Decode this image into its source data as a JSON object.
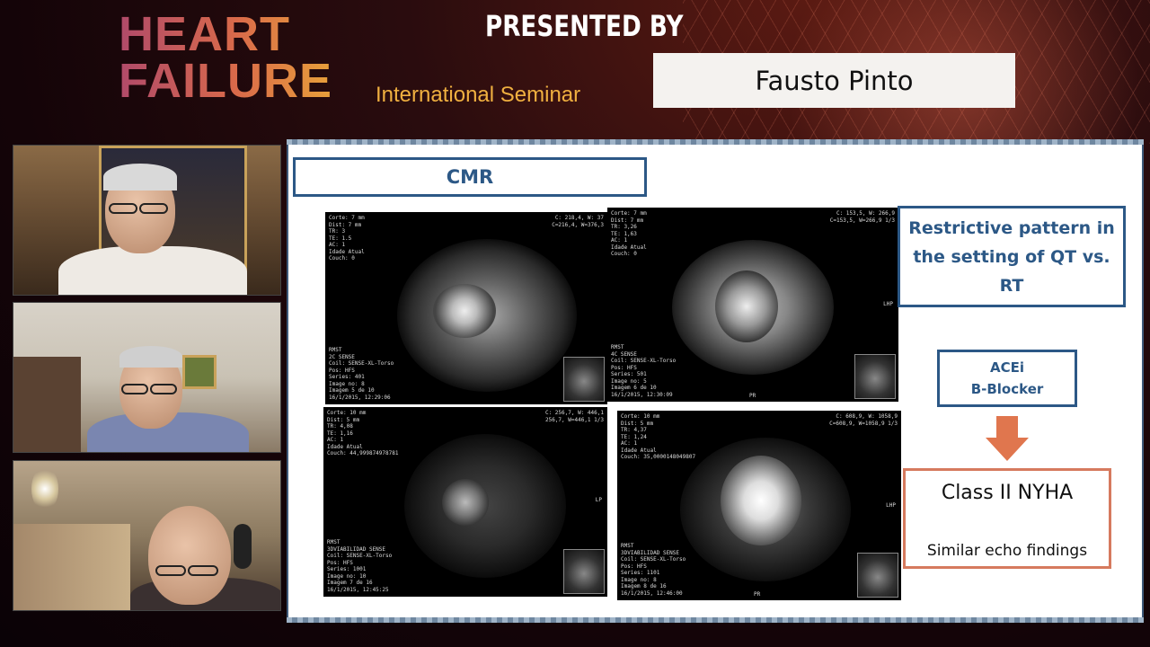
{
  "header": {
    "logo_line1": "HEART",
    "logo_line2": "FAILURE",
    "seminar": "International Seminar",
    "presented_by": "PRESENTED BY",
    "presenter_name": "Fausto Pinto"
  },
  "slide": {
    "title": "CMR",
    "restrictive_text": "Restrictive pattern in the setting of QT vs. RT",
    "drugs_line1": "ACEi",
    "drugs_line2": "B-Blocker",
    "class_title": "Class II NYHA",
    "class_sub": "Similar echo findings",
    "images": [
      {
        "meta_tl": "Corte: 7 mm\nDist: 7 mm\nTR: 3\nTE: 1.5\nAC: 1\nIdade Atual\nCouch: 0",
        "meta_tr": "C: 218,4, W: 37\nC=216,4, W=376,3",
        "meta_bl": "RMST\n2C SENSE\nCoil: SENSE-XL-Torso\nPos: HFS\nSeries: 401\nImage no: 8\nImagem 5 de 10\n16/1/2015, 12:29:06"
      },
      {
        "meta_tl": "Corte: 7 mm\nDist: 7 mm\nTR: 3,26\nTE: 1,63\nAC: 1\nIdade Atual\nCouch: 0",
        "meta_tr": "C: 153,5, W: 266,9\nC=153,5, W=266,9 1/3",
        "meta_bl": "RMST\n4C SENSE\nCoil: SENSE-XL-Torso\nPos: HFS\nSeries: 501\nImage no: 5\nImagem 6 de 10\n16/1/2015, 12:30:09",
        "side": "LHP",
        "bottom": "PR"
      },
      {
        "meta_tl": "Corte: 10 mm\nDist: 5 mm\nTR: 4,08\nTE: 1,16\nAC: 1\nIdade Atual\nCouch: 44,999874978781",
        "meta_tr": "C: 256,7, W: 446,1\n256,7, W=446,1 1/3",
        "meta_bl": "RMST\n3DVIABILIDAD SENSE\nCoil: SENSE-XL-Torso\nPos: HFS\nSeries: 1001\nImage no: 10\nImagem 7 de 16\n16/1/2015, 12:45:25",
        "side": "LP"
      },
      {
        "meta_tl": "Corte: 10 mm\nDist: 5 mm\nTR: 4,37\nTE: 1,24\nAC: 1\nIdade Atual\nCouch: 35,0000148049807",
        "meta_tr": "C: 608,9, W: 1058,9\nC=608,9, W=1058,9 1/3",
        "meta_bl": "RMST\n3DVIABILIDAD SENSE\nCoil: SENSE-XL-Torso\nPos: HFS\nSeries: 1101\nImage no: 8\nImagem 8 de 16\n16/1/2015, 12:46:00",
        "side": "LHP",
        "bottom": "PR"
      }
    ]
  },
  "colors": {
    "slide_accent": "#2c5886",
    "class_border": "#d67a5e",
    "arrow": "#e0764e"
  }
}
